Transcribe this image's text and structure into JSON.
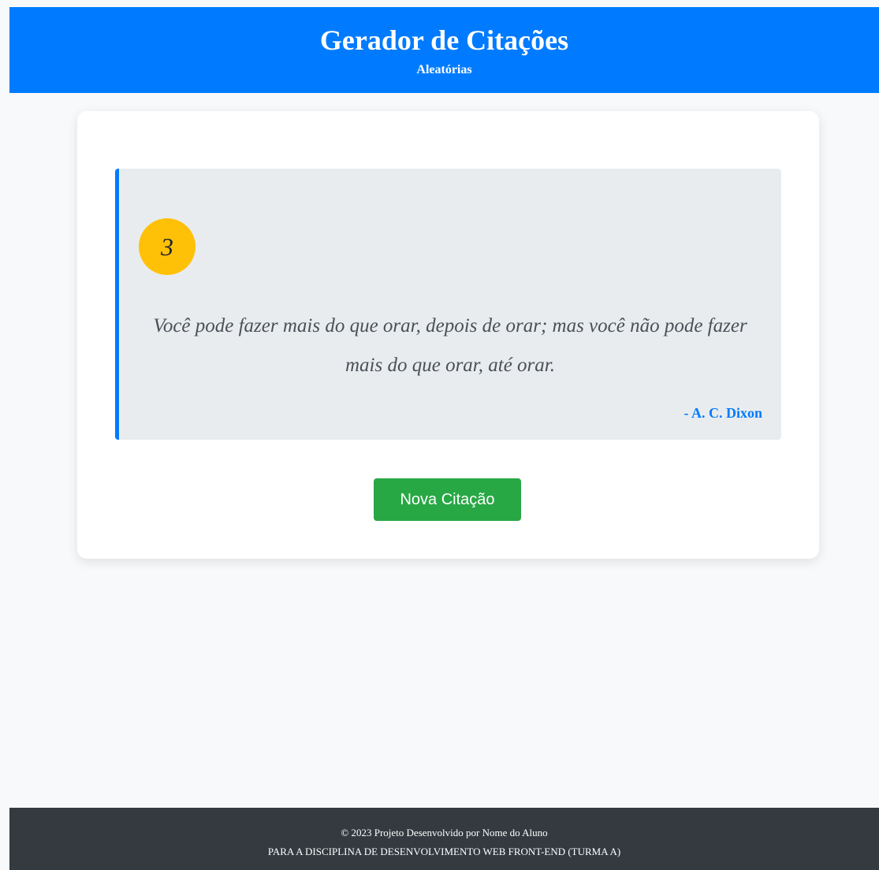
{
  "header": {
    "title": "Gerador de Citações",
    "subtitle": "Aleatórias"
  },
  "quote": {
    "number": "3",
    "text": "Você pode fazer mais do que orar, depois de orar; mas você não pode fazer mais do que orar, até orar.",
    "author": "- A. C. Dixon"
  },
  "actions": {
    "new_quote_label": "Nova Citação"
  },
  "footer": {
    "line1": "© 2023 Projeto Desenvolvido por Nome do Aluno",
    "line2": "PARA A DISCIPLINA DE DESENVOLVIMENTO WEB FRONT-END (TURMA A)"
  },
  "colors": {
    "header_bg": "#007bff",
    "accent": "#007bff",
    "badge": "#ffc107",
    "button": "#28a745",
    "footer_bg": "#343a40"
  }
}
